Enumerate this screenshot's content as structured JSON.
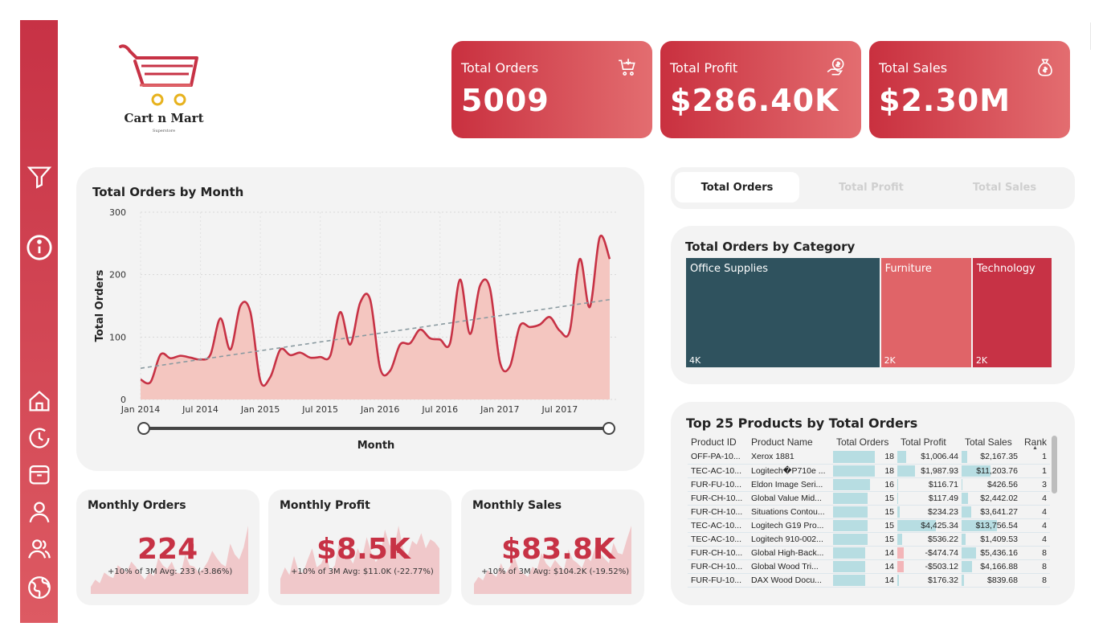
{
  "brand": {
    "name": "Cart n Mart",
    "tagline": "Superstore"
  },
  "colors": {
    "accent": "#c73245",
    "accent_light": "#e36d70",
    "teal": "#2f525e",
    "area_fill": "#f4c6c0",
    "line": "#c73245"
  },
  "sidebar": {
    "icons": [
      "filter-icon",
      "info-icon",
      "home-icon",
      "clock-icon",
      "box-icon",
      "user-icon",
      "users-icon",
      "globe-icon"
    ]
  },
  "kpis": [
    {
      "title": "Total Orders",
      "value": "5009",
      "icon": "cart-icon"
    },
    {
      "title": "Total Profit",
      "value": "$286.40K",
      "icon": "money-hand-icon"
    },
    {
      "title": "Total Sales",
      "value": "$2.30M",
      "icon": "money-bag-icon"
    }
  ],
  "tabs": [
    {
      "label": "Total Orders",
      "active": true
    },
    {
      "label": "Total Profit",
      "active": false
    },
    {
      "label": "Total Sales",
      "active": false
    }
  ],
  "chart_data": [
    {
      "type": "area",
      "title": "Total Orders by Month",
      "xlabel": "Month",
      "ylabel": "Total Orders",
      "ylim": [
        0,
        300
      ],
      "yticks": [
        "0",
        "100",
        "200",
        "300"
      ],
      "xticks": [
        "Jan 2014",
        "Jul 2014",
        "Jan 2015",
        "Jul 2015",
        "Jan 2016",
        "Jul 2016",
        "Jan 2017",
        "Jul 2017"
      ],
      "grid": true,
      "trend_line": [
        50,
        160
      ],
      "series": [
        {
          "values": [
            32,
            28,
            72,
            66,
            70,
            67,
            64,
            72,
            130,
            80,
            150,
            140,
            30,
            36,
            80,
            71,
            75,
            67,
            68,
            70,
            140,
            88,
            155,
            160,
            50,
            46,
            88,
            90,
            112,
            98,
            96,
            90,
            192,
            105,
            182,
            178,
            60,
            53,
            118,
            116,
            120,
            132,
            110,
            110,
            225,
            148,
            260,
            225
          ]
        }
      ]
    },
    {
      "type": "treemap",
      "title": "Total Orders by Category",
      "categories": [
        "Office Supplies",
        "Furniture",
        "Technology"
      ],
      "values": [
        3742,
        1764,
        1544
      ],
      "labels": [
        "4K",
        "2K",
        "2K"
      ]
    }
  ],
  "slider": {
    "start": "Jan 2014",
    "end": "Dec 2017"
  },
  "products": {
    "title": "Top 25 Products by Total Orders",
    "columns": [
      "Product ID",
      "Product Name",
      "Total Orders",
      "Total Profit",
      "Total Sales",
      "Rank"
    ],
    "rows": [
      {
        "id": "OFF-PA-10...",
        "name": "Xerox 1881",
        "orders": "18",
        "orders_v": 18,
        "profit": "$1,006.44",
        "profit_v": 1006.44,
        "sales": "$2,167.35",
        "sales_v": 2167.35,
        "rank": "1"
      },
      {
        "id": "TEC-AC-10...",
        "name": "Logitech�P710e ...",
        "orders": "18",
        "orders_v": 18,
        "profit": "$1,987.93",
        "profit_v": 1987.93,
        "sales": "$11,203.76",
        "sales_v": 11203.76,
        "rank": "1"
      },
      {
        "id": "FUR-FU-10...",
        "name": "Eldon Image Seri...",
        "orders": "16",
        "orders_v": 16,
        "profit": "$116.71",
        "profit_v": 116.71,
        "sales": "$426.56",
        "sales_v": 426.56,
        "rank": "3"
      },
      {
        "id": "FUR-CH-10...",
        "name": "Global Value Mid...",
        "orders": "15",
        "orders_v": 15,
        "profit": "$117.49",
        "profit_v": 117.49,
        "sales": "$2,442.02",
        "sales_v": 2442.02,
        "rank": "4"
      },
      {
        "id": "FUR-CH-10...",
        "name": "Situations Contou...",
        "orders": "15",
        "orders_v": 15,
        "profit": "$234.23",
        "profit_v": 234.23,
        "sales": "$3,641.27",
        "sales_v": 3641.27,
        "rank": "4"
      },
      {
        "id": "TEC-AC-10...",
        "name": "Logitech G19 Pro...",
        "orders": "15",
        "orders_v": 15,
        "profit": "$4,425.34",
        "profit_v": 4425.34,
        "sales": "$13,756.54",
        "sales_v": 13756.54,
        "rank": "4"
      },
      {
        "id": "TEC-AC-10...",
        "name": "Logitech 910-002...",
        "orders": "15",
        "orders_v": 15,
        "profit": "$536.22",
        "profit_v": 536.22,
        "sales": "$1,409.53",
        "sales_v": 1409.53,
        "rank": "4"
      },
      {
        "id": "FUR-CH-10...",
        "name": "Global High-Back...",
        "orders": "14",
        "orders_v": 14,
        "profit": "-$474.74",
        "profit_v": -474.74,
        "sales": "$5,436.16",
        "sales_v": 5436.16,
        "rank": "8"
      },
      {
        "id": "FUR-CH-10...",
        "name": "Global Wood Tri...",
        "orders": "14",
        "orders_v": 14,
        "profit": "-$503.12",
        "profit_v": -503.12,
        "sales": "$4,166.88",
        "sales_v": 4166.88,
        "rank": "8"
      },
      {
        "id": "FUR-FU-10...",
        "name": "DAX Wood Docu...",
        "orders": "14",
        "orders_v": 14,
        "profit": "$176.32",
        "profit_v": 176.32,
        "sales": "$839.68",
        "sales_v": 839.68,
        "rank": "8"
      }
    ]
  },
  "monthly": [
    {
      "title": "Monthly Orders",
      "value": "224",
      "sub": "+10% of 3M Avg: 233 (-3.86%)",
      "spark": [
        10,
        20,
        15,
        30,
        25,
        22,
        40,
        35,
        30,
        45,
        38,
        28,
        20,
        30,
        25,
        50,
        40,
        35,
        45,
        30,
        28,
        55,
        40,
        38,
        30,
        35,
        45,
        60,
        50,
        42,
        38,
        70,
        55,
        48,
        65,
        95
      ]
    },
    {
      "title": "Monthly Profit",
      "value": "$8.5K",
      "sub": "+10% of 3M Avg: $11.0K (-22.77%)",
      "spark": [
        20,
        35,
        25,
        50,
        30,
        28,
        45,
        60,
        35,
        40,
        55,
        30,
        38,
        70,
        45,
        50,
        40,
        60,
        48,
        75,
        55,
        42,
        50,
        85,
        65,
        58,
        90,
        60,
        50,
        70,
        65,
        80,
        60,
        72,
        68,
        60
      ]
    },
    {
      "title": "Monthly Sales",
      "value": "$83.8K",
      "sub": "+10% of 3M Avg: $104.2K (-19.52%)",
      "spark": [
        15,
        25,
        20,
        35,
        30,
        25,
        45,
        30,
        40,
        55,
        35,
        30,
        25,
        40,
        35,
        60,
        45,
        38,
        50,
        42,
        35,
        65,
        50,
        45,
        38,
        55,
        48,
        70,
        60,
        52,
        45,
        75,
        60,
        58,
        80,
        100
      ]
    }
  ]
}
